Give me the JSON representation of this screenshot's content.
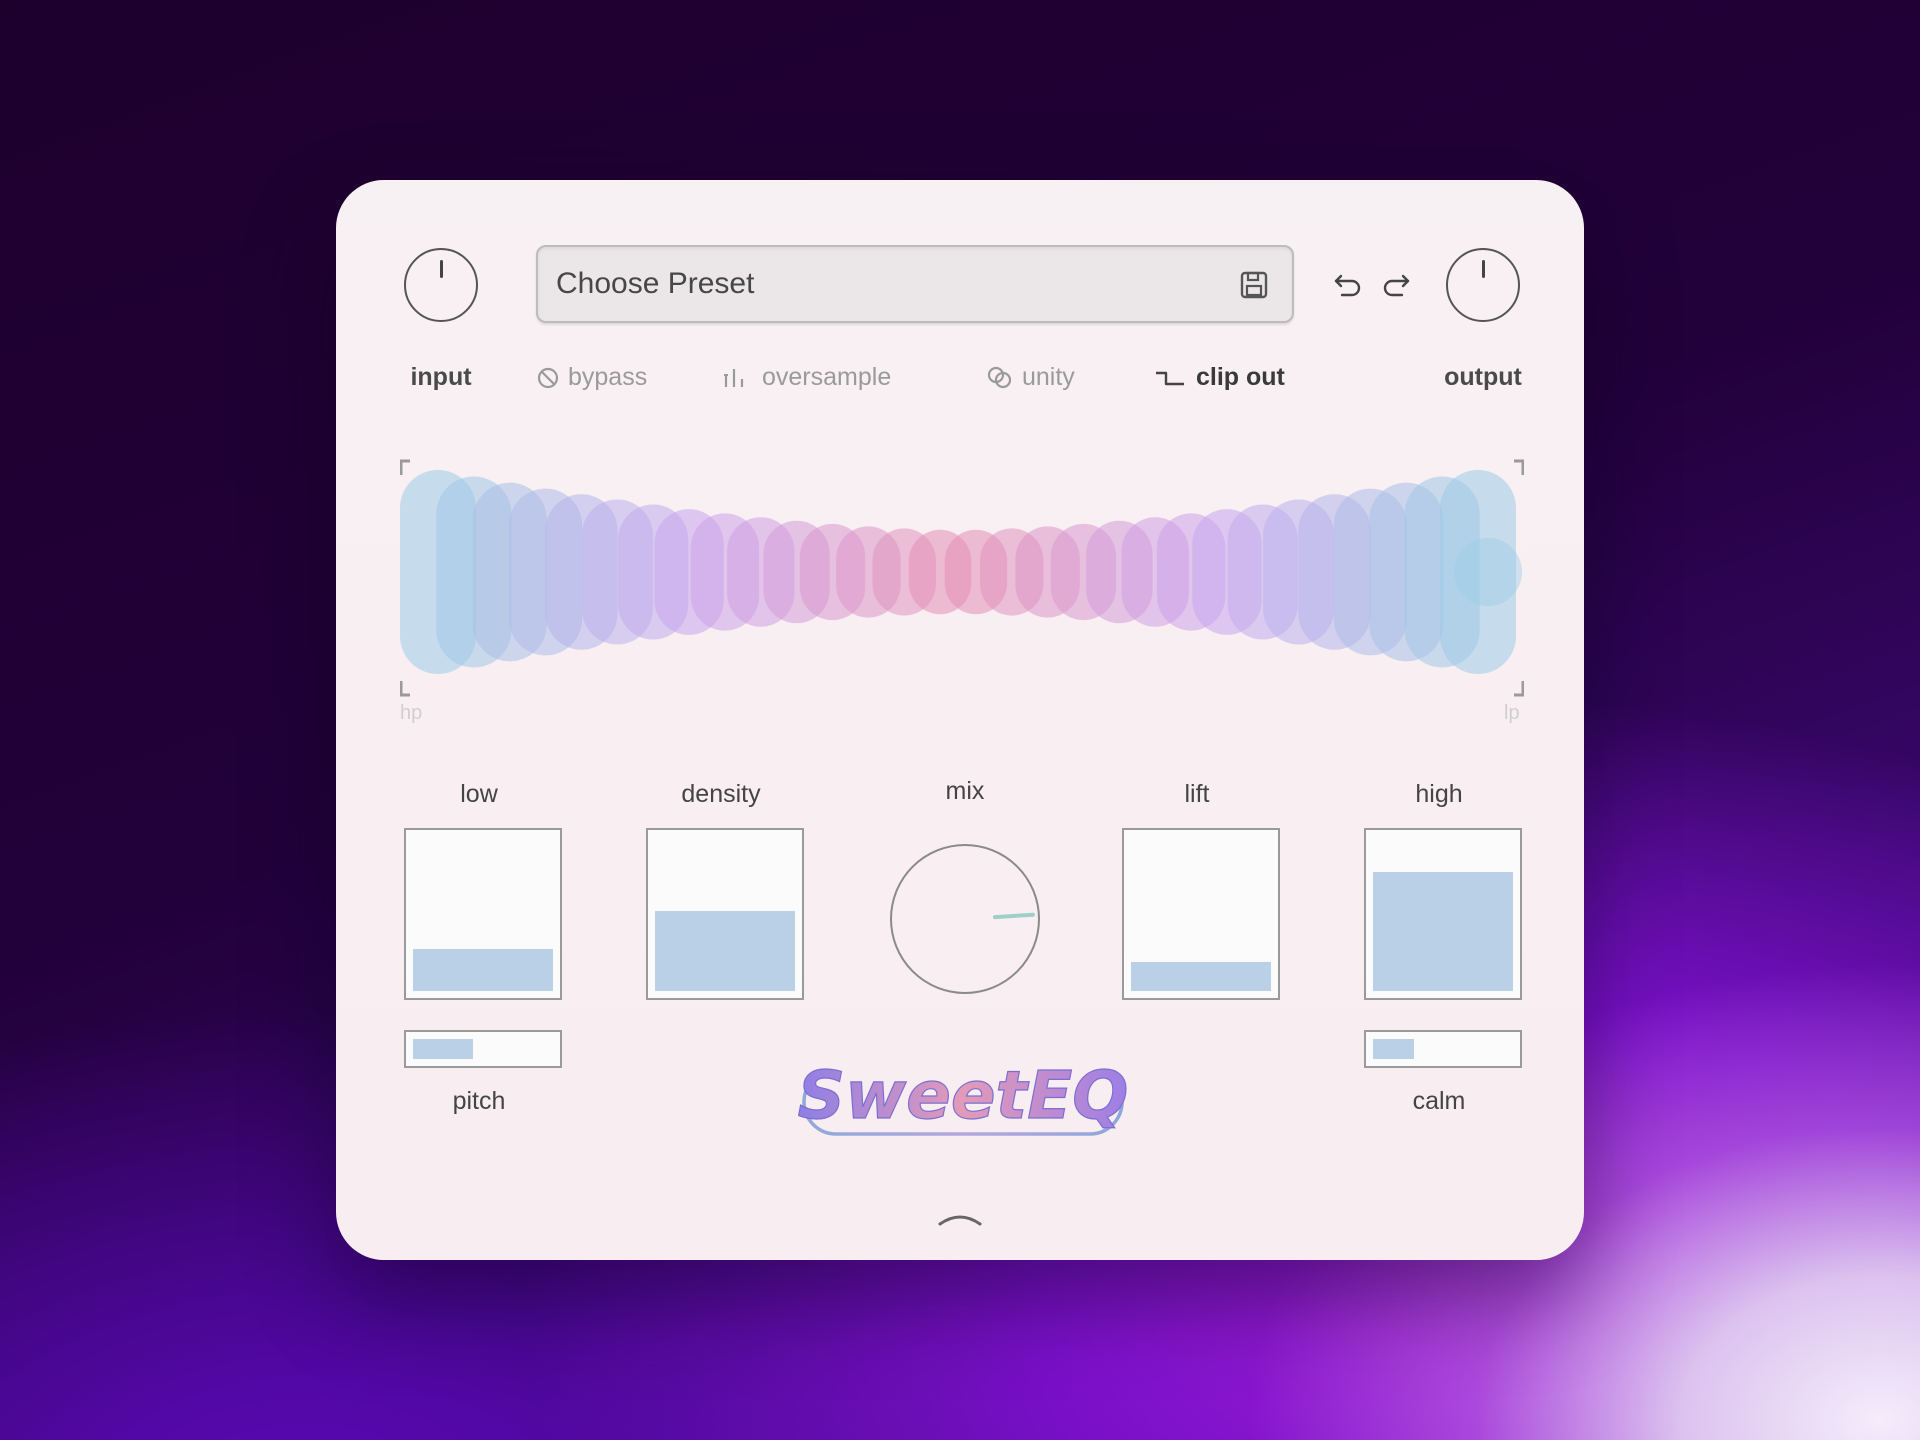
{
  "header": {
    "input_label": "input",
    "output_label": "output",
    "preset": {
      "placeholder": "Choose Preset"
    },
    "options": [
      {
        "label": "bypass",
        "icon": "bypass-icon",
        "active": false
      },
      {
        "label": "oversample",
        "icon": "oversample-icon",
        "active": false
      },
      {
        "label": "unity",
        "icon": "unity-icon",
        "active": false
      },
      {
        "label": "clip out",
        "icon": "clip-icon",
        "active": true
      }
    ],
    "icons": {
      "save": "save-icon",
      "undo": "undo-icon",
      "redo": "redo-icon"
    }
  },
  "visualizer": {
    "left_label": "hp",
    "right_label": "lp",
    "colors": {
      "edge": "#9ccbe6",
      "mid": "#c9a4ef",
      "center": "#e68fb3"
    }
  },
  "controls": {
    "low": {
      "label": "low",
      "value": 0.27
    },
    "density": {
      "label": "density",
      "value": 0.52
    },
    "mix": {
      "label": "mix",
      "value": 0.82
    },
    "lift": {
      "label": "lift",
      "value": 0.19
    },
    "high": {
      "label": "high",
      "value": 0.77
    },
    "pitch": {
      "label": "pitch",
      "value": 0.43
    },
    "calm": {
      "label": "calm",
      "value": 0.29
    }
  },
  "logo": {
    "text": "SweetEQ"
  },
  "footer": {
    "expand_icon": "chevron-up-icon"
  },
  "theme": {
    "slider_fill": "#bad0e6",
    "panel_bg": "#f8f0f2"
  }
}
